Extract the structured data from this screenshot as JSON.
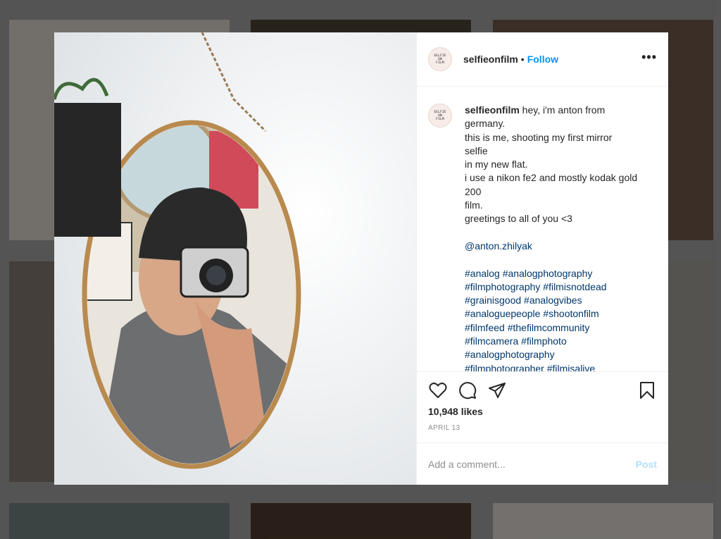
{
  "post": {
    "username": "selfieonfilm",
    "follow_label": "Follow",
    "separator": "•",
    "more_label": "•••",
    "avatar_text": [
      "SELFIE",
      "ON",
      "FILM"
    ],
    "caption": {
      "username": "selfieonfilm",
      "lines": [
        " hey, i'm anton from",
        "germany.",
        "this is me, shooting my first mirror",
        "selfie",
        "in my new flat.",
        "i use a nikon fe2 and mostly kodak gold",
        "200",
        "film.",
        "greetings to all of you <3"
      ],
      "mention": "@anton.zhilyak",
      "hashtag_lines": [
        "#analog #analogphotography",
        "#filmphotography #filmisnotdead",
        "#grainisgood #analogvibes",
        "#analoguepeople #shootonfilm",
        "#filmfeed #thefilmcommunity",
        "#filmcamera #filmphoto",
        "#analogphotography",
        "#filmphotographer #filmisalive"
      ]
    },
    "likes": "10,948 likes",
    "date": "APRIL 13",
    "comment_placeholder": "Add a comment...",
    "post_label": "Post"
  },
  "icons": {
    "like": "heart-icon",
    "comment": "comment-icon",
    "share": "paper-plane-icon",
    "save": "bookmark-icon"
  },
  "colors": {
    "link": "#00376b",
    "follow": "#0095f6",
    "post_disabled": "#b2dffc",
    "frame": "#b98a4e"
  }
}
